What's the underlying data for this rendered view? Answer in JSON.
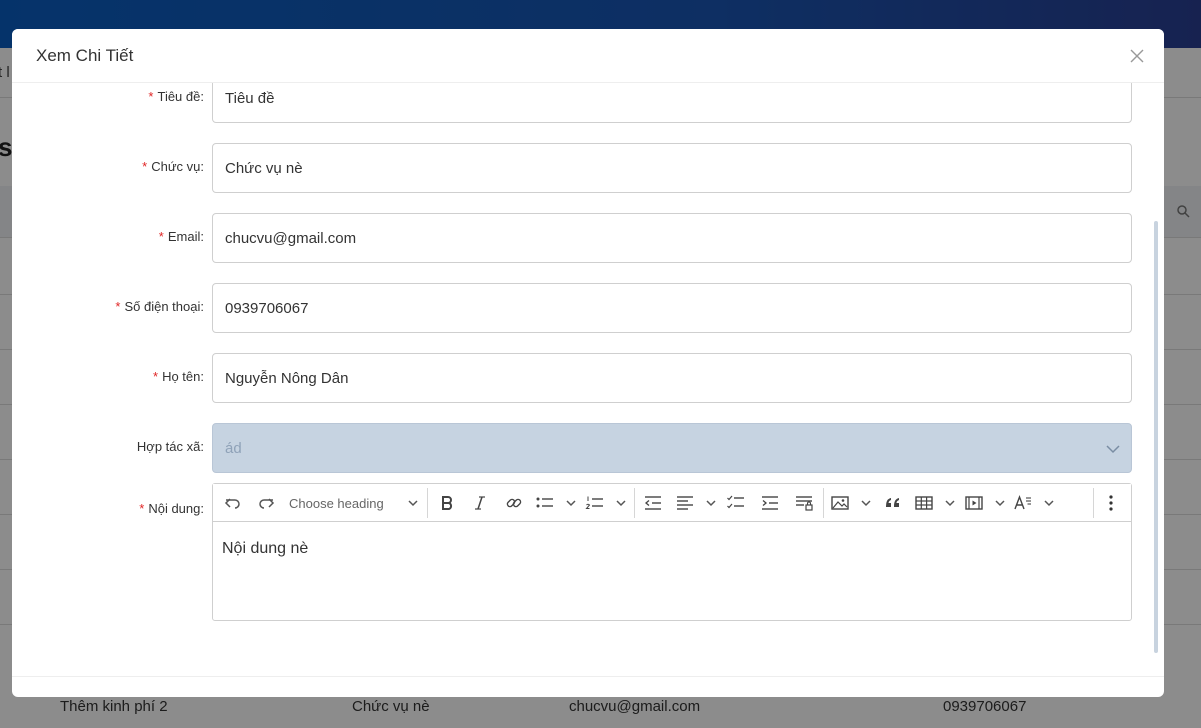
{
  "background": {
    "subbar_fragment": "t l",
    "title_fragment": "s",
    "last_row": {
      "col1": "Thêm kinh phí 2",
      "col2": "Chức vụ nè",
      "col3": "chucvu@gmail.com",
      "col4": "0939706067"
    }
  },
  "modal": {
    "title": "Xem Chi Tiết",
    "close_icon": "close-icon"
  },
  "form": {
    "tieu_de": {
      "label": "Tiêu đề",
      "value": "Tiêu đề"
    },
    "chuc_vu": {
      "label": "Chức vụ",
      "value": "Chức vụ nè"
    },
    "email": {
      "label": "Email",
      "value": "chucvu@gmail.com"
    },
    "so_dien_thoai": {
      "label": "Số điện thoại",
      "value": "0939706067"
    },
    "ho_ten": {
      "label": "Họ tên",
      "value": "Nguyễn Nông Dân"
    },
    "hop_tac_xa": {
      "label": "Hợp tác xã",
      "value": "ád"
    },
    "noi_dung": {
      "label": "Nội dung",
      "value": "Nội dung nè"
    },
    "colon": ":",
    "required_mark": "*"
  },
  "editor": {
    "heading_placeholder": "Choose heading"
  },
  "colors": {
    "header_blue": "#1a56b4",
    "required_red": "#e02424",
    "disabled_fill": "#c6d3e1"
  }
}
